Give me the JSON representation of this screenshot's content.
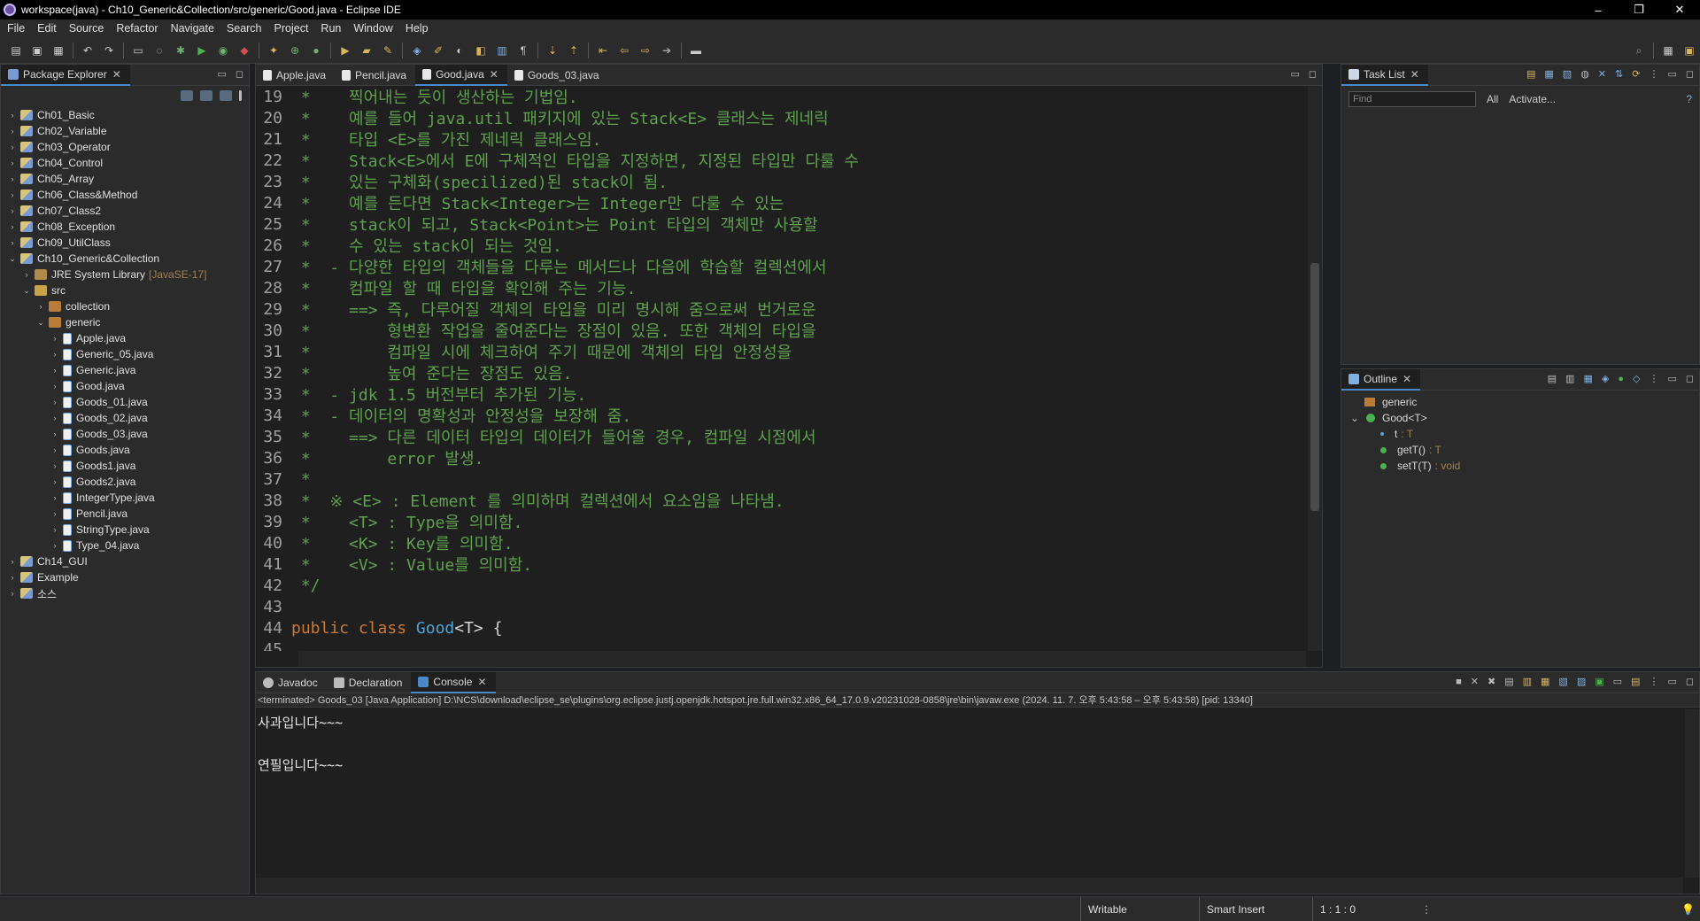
{
  "window": {
    "title": "workspace(java) - Ch10_Generic&Collection/src/generic/Good.java - Eclipse IDE",
    "minimize": "–",
    "restore": "❐",
    "close": "✕"
  },
  "menu": [
    "File",
    "Edit",
    "Source",
    "Refactor",
    "Navigate",
    "Search",
    "Project",
    "Run",
    "Window",
    "Help"
  ],
  "package_explorer": {
    "title": "Package Explorer",
    "items": [
      {
        "label": "Ch01_Basic",
        "indent": 0,
        "type": "project",
        "expanded": false
      },
      {
        "label": "Ch02_Variable",
        "indent": 0,
        "type": "project",
        "expanded": false
      },
      {
        "label": "Ch03_Operator",
        "indent": 0,
        "type": "project",
        "expanded": false
      },
      {
        "label": "Ch04_Control",
        "indent": 0,
        "type": "project",
        "expanded": false
      },
      {
        "label": "Ch05_Array",
        "indent": 0,
        "type": "project",
        "expanded": false
      },
      {
        "label": "Ch06_Class&Method",
        "indent": 0,
        "type": "project",
        "expanded": false
      },
      {
        "label": "Ch07_Class2",
        "indent": 0,
        "type": "project",
        "expanded": false
      },
      {
        "label": "Ch08_Exception",
        "indent": 0,
        "type": "project",
        "expanded": false
      },
      {
        "label": "Ch09_UtilClass",
        "indent": 0,
        "type": "project",
        "expanded": false
      },
      {
        "label": "Ch10_Generic&Collection",
        "indent": 0,
        "type": "project",
        "expanded": true
      },
      {
        "label": "JRE System Library",
        "suffix": "[JavaSE-17]",
        "indent": 1,
        "type": "lib",
        "expanded": false
      },
      {
        "label": "src",
        "indent": 1,
        "type": "src",
        "expanded": true
      },
      {
        "label": "collection",
        "indent": 2,
        "type": "pkg",
        "expanded": false
      },
      {
        "label": "generic",
        "indent": 2,
        "type": "pkg",
        "expanded": true
      },
      {
        "label": "Apple.java",
        "indent": 3,
        "type": "java",
        "expanded": false
      },
      {
        "label": "Generic_05.java",
        "indent": 3,
        "type": "java",
        "expanded": false
      },
      {
        "label": "Generic.java",
        "indent": 3,
        "type": "java",
        "expanded": false
      },
      {
        "label": "Good.java",
        "indent": 3,
        "type": "java",
        "expanded": false
      },
      {
        "label": "Goods_01.java",
        "indent": 3,
        "type": "java",
        "expanded": false
      },
      {
        "label": "Goods_02.java",
        "indent": 3,
        "type": "java",
        "expanded": false
      },
      {
        "label": "Goods_03.java",
        "indent": 3,
        "type": "java",
        "expanded": false
      },
      {
        "label": "Goods.java",
        "indent": 3,
        "type": "java",
        "expanded": false
      },
      {
        "label": "Goods1.java",
        "indent": 3,
        "type": "java",
        "expanded": false
      },
      {
        "label": "Goods2.java",
        "indent": 3,
        "type": "java",
        "expanded": false
      },
      {
        "label": "IntegerType.java",
        "indent": 3,
        "type": "java",
        "expanded": false
      },
      {
        "label": "Pencil.java",
        "indent": 3,
        "type": "java",
        "expanded": false
      },
      {
        "label": "StringType.java",
        "indent": 3,
        "type": "java",
        "expanded": false
      },
      {
        "label": "Type_04.java",
        "indent": 3,
        "type": "java",
        "expanded": false
      },
      {
        "label": "Ch14_GUI",
        "indent": 0,
        "type": "project",
        "expanded": false
      },
      {
        "label": "Example",
        "indent": 0,
        "type": "project",
        "expanded": false
      },
      {
        "label": "소스",
        "indent": 0,
        "type": "project",
        "expanded": false
      }
    ]
  },
  "editor": {
    "tabs": [
      {
        "label": "Apple.java",
        "active": false
      },
      {
        "label": "Pencil.java",
        "active": false
      },
      {
        "label": "Good.java",
        "active": true
      },
      {
        "label": "Goods_03.java",
        "active": false
      }
    ],
    "lines": [
      {
        "n": "19",
        "parts": [
          [
            "ct",
            " *    찍어내는 듯이 생산하는 기법임."
          ]
        ]
      },
      {
        "n": "20",
        "parts": [
          [
            "ct",
            " *    예를 들어 java.util 패키지에 있는 Stack<E> 클래스는 제네릭"
          ]
        ]
      },
      {
        "n": "21",
        "parts": [
          [
            "ct",
            " *    타입 <E>를 가진 제네릭 클래스임."
          ]
        ]
      },
      {
        "n": "22",
        "parts": [
          [
            "ct",
            " *    Stack<E>에서 E에 구체적인 타입을 지정하면, 지정된 타입만 다룰 수"
          ]
        ]
      },
      {
        "n": "23",
        "parts": [
          [
            "ct",
            " *    있는 구체화(specilized)된 stack이 됨."
          ]
        ]
      },
      {
        "n": "24",
        "parts": [
          [
            "ct",
            " *    예를 든다면 Stack<Integer>는 Integer만 다룰 수 있는"
          ]
        ]
      },
      {
        "n": "25",
        "parts": [
          [
            "ct",
            " *    stack이 되고, Stack<Point>는 Point 타입의 객체만 사용할"
          ]
        ]
      },
      {
        "n": "26",
        "parts": [
          [
            "ct",
            " *    수 있는 stack이 되는 것임."
          ]
        ]
      },
      {
        "n": "27",
        "parts": [
          [
            "ct",
            " *  - 다양한 타입의 객체들을 다루는 메서드나 다음에 학습할 컬렉션에서"
          ]
        ]
      },
      {
        "n": "28",
        "parts": [
          [
            "ct",
            " *    컴파일 할 때 타입을 확인해 주는 기능."
          ]
        ]
      },
      {
        "n": "29",
        "parts": [
          [
            "ct",
            " *    ==> 즉, 다루어질 객체의 타입을 미리 명시해 줌으로써 번거로운"
          ]
        ]
      },
      {
        "n": "30",
        "parts": [
          [
            "ct",
            " *        형변환 작업을 줄여준다는 장점이 있음. 또한 객체의 타입을"
          ]
        ]
      },
      {
        "n": "31",
        "parts": [
          [
            "ct",
            " *        컴파일 시에 체크하여 주기 때문에 객체의 타입 안정성을"
          ]
        ]
      },
      {
        "n": "32",
        "parts": [
          [
            "ct",
            " *        높여 준다는 장점도 있음."
          ]
        ]
      },
      {
        "n": "33",
        "parts": [
          [
            "ct",
            " *  - jdk 1.5 버전부터 추가된 기능."
          ]
        ]
      },
      {
        "n": "34",
        "parts": [
          [
            "ct",
            " *  - 데이터의 명확성과 안정성을 보장해 줌."
          ]
        ]
      },
      {
        "n": "35",
        "parts": [
          [
            "ct",
            " *    ==> 다른 데이터 타입의 데이터가 들어올 경우, 컴파일 시점에서"
          ]
        ]
      },
      {
        "n": "36",
        "parts": [
          [
            "ct",
            " *        error 발생."
          ]
        ]
      },
      {
        "n": "37",
        "parts": [
          [
            "ct",
            " *"
          ]
        ]
      },
      {
        "n": "38",
        "parts": [
          [
            "ct",
            " *  ※ <E> : Element 를 의미하며 컬렉션에서 요소임을 나타냄."
          ]
        ]
      },
      {
        "n": "39",
        "parts": [
          [
            "ct",
            " *    <T> : Type을 의미함."
          ]
        ]
      },
      {
        "n": "40",
        "parts": [
          [
            "ct",
            " *    <K> : Key를 의미함."
          ]
        ]
      },
      {
        "n": "41",
        "parts": [
          [
            "ct",
            " *    <V> : Value를 의미함."
          ]
        ]
      },
      {
        "n": "42",
        "parts": [
          [
            "ct",
            " */"
          ]
        ]
      },
      {
        "n": "43",
        "parts": [
          [
            "plain",
            ""
          ]
        ]
      },
      {
        "n": "44",
        "parts": [
          [
            "kw",
            "public class "
          ],
          [
            "cls",
            "Good"
          ],
          [
            "plain",
            "<T> {"
          ]
        ]
      },
      {
        "n": "45",
        "parts": [
          [
            "plain",
            ""
          ]
        ]
      }
    ]
  },
  "task_list": {
    "title": "Task List",
    "find_placeholder": "Find",
    "all_label": "All",
    "activate_label": "Activate..."
  },
  "outline": {
    "title": "Outline",
    "items": [
      {
        "label": "generic",
        "type": "",
        "kind": "package"
      },
      {
        "label": "Good<T>",
        "type": "",
        "kind": "class"
      },
      {
        "label": "t",
        "type": ": T",
        "kind": "field"
      },
      {
        "label": "getT()",
        "type": ": T",
        "kind": "method"
      },
      {
        "label": "setT(T)",
        "type": ": void",
        "kind": "method"
      }
    ]
  },
  "console": {
    "tabs": [
      {
        "label": "Javadoc",
        "active": false
      },
      {
        "label": "Declaration",
        "active": false
      },
      {
        "label": "Console",
        "active": true
      }
    ],
    "terminated": "<terminated> Goods_03 [Java Application] D:\\NCS\\download\\eclipse_se\\plugins\\org.eclipse.justj.openjdk.hotspot.jre.full.win32.x86_64_17.0.9.v20231028-0858\\jre\\bin\\javaw.exe  (2024. 11. 7. 오후 5:43:58 – 오후 5:43:58) [pid: 13340]",
    "output": [
      "사과입니다~~~",
      "",
      "연필입니다~~~"
    ]
  },
  "status": {
    "writable": "Writable",
    "insert_mode": "Smart Insert",
    "position": "1 : 1 : 0"
  }
}
